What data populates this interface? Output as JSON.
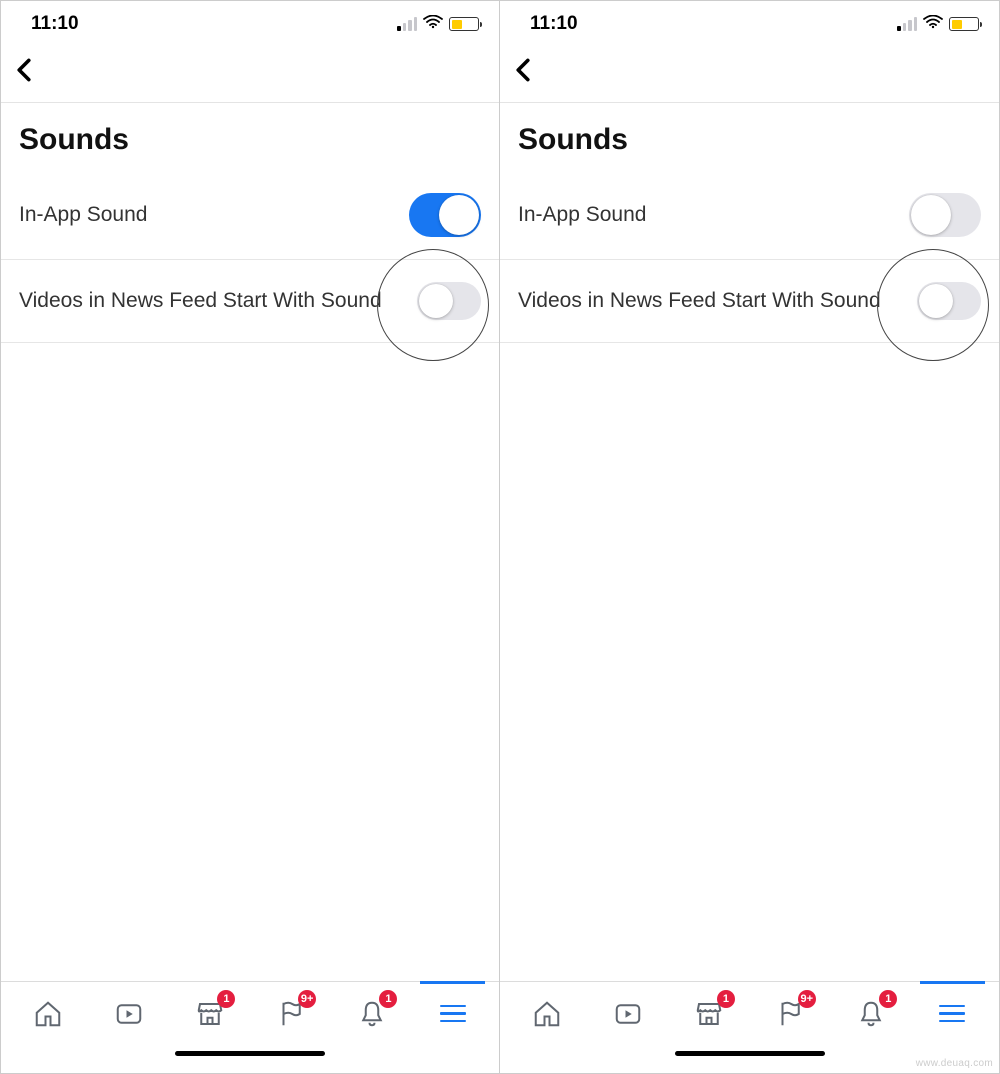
{
  "status": {
    "time": "11:10",
    "signal_bars_active": 1,
    "battery_percent": 42,
    "battery_color": "#ffcc00"
  },
  "page": {
    "title": "Sounds",
    "settings": [
      {
        "id": "in-app-sound",
        "label": "In-App Sound",
        "toggle_on_left": true,
        "toggle_on_right": false,
        "highlighted": true
      },
      {
        "id": "videos-sound",
        "label": "Videos in News Feed Start With Sound",
        "toggle_on_left": false,
        "toggle_on_right": false,
        "highlighted": false
      }
    ]
  },
  "tabs": {
    "items": [
      {
        "id": "home",
        "icon": "home-icon",
        "badge": null
      },
      {
        "id": "watch",
        "icon": "watch-icon",
        "badge": null
      },
      {
        "id": "marketplace",
        "icon": "marketplace-icon",
        "badge": "1"
      },
      {
        "id": "groups",
        "icon": "flag-icon",
        "badge": "9+"
      },
      {
        "id": "notifications",
        "icon": "bell-icon",
        "badge": "1"
      },
      {
        "id": "menu",
        "icon": "hamburger-icon",
        "badge": null,
        "active": true
      }
    ]
  },
  "watermark": "www.deuaq.com"
}
